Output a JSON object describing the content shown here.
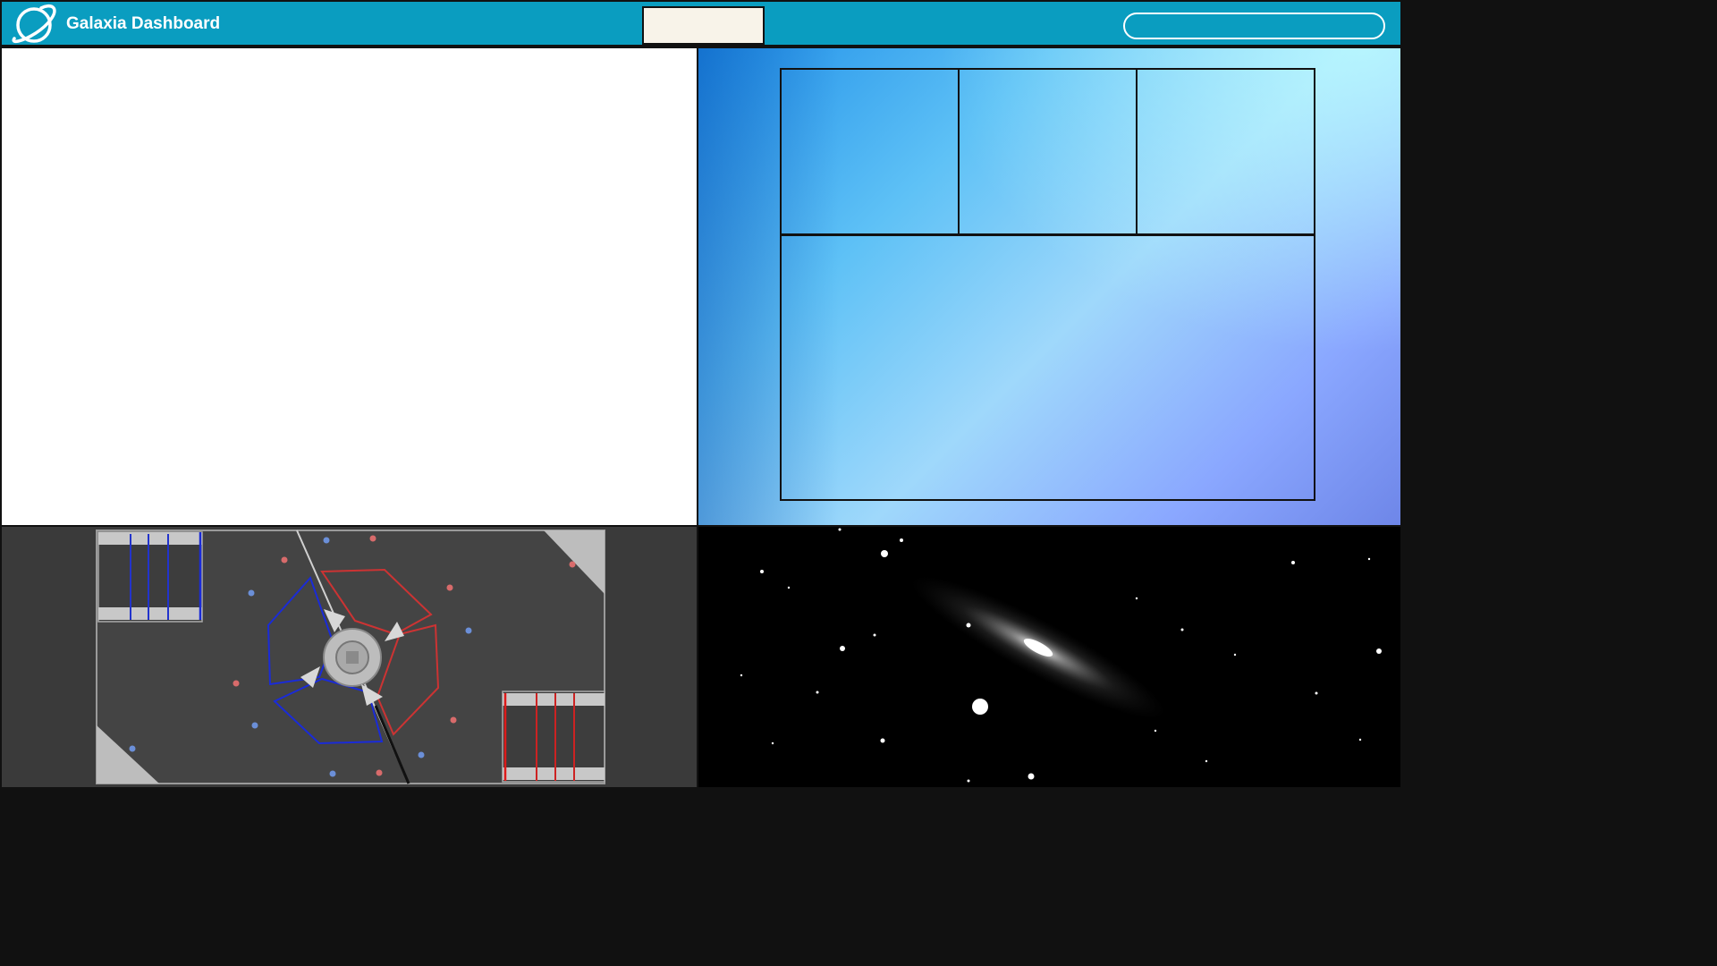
{
  "header": {
    "title": "Galaxia Dashboard",
    "logo_icon": "planet-ring-icon",
    "accent_color": "#0a9dc0",
    "search_placeholder": ""
  },
  "panels": {
    "top_left": {
      "background": "#ffffff"
    },
    "top_right": {
      "layout": "three-cells-over-one",
      "background": "sky-blue-gradient"
    },
    "bottom_left": {
      "content": "robotics-field-map",
      "alliances": [
        "blue",
        "red"
      ]
    },
    "bottom_right": {
      "content": "galaxy-telescope-image"
    }
  }
}
